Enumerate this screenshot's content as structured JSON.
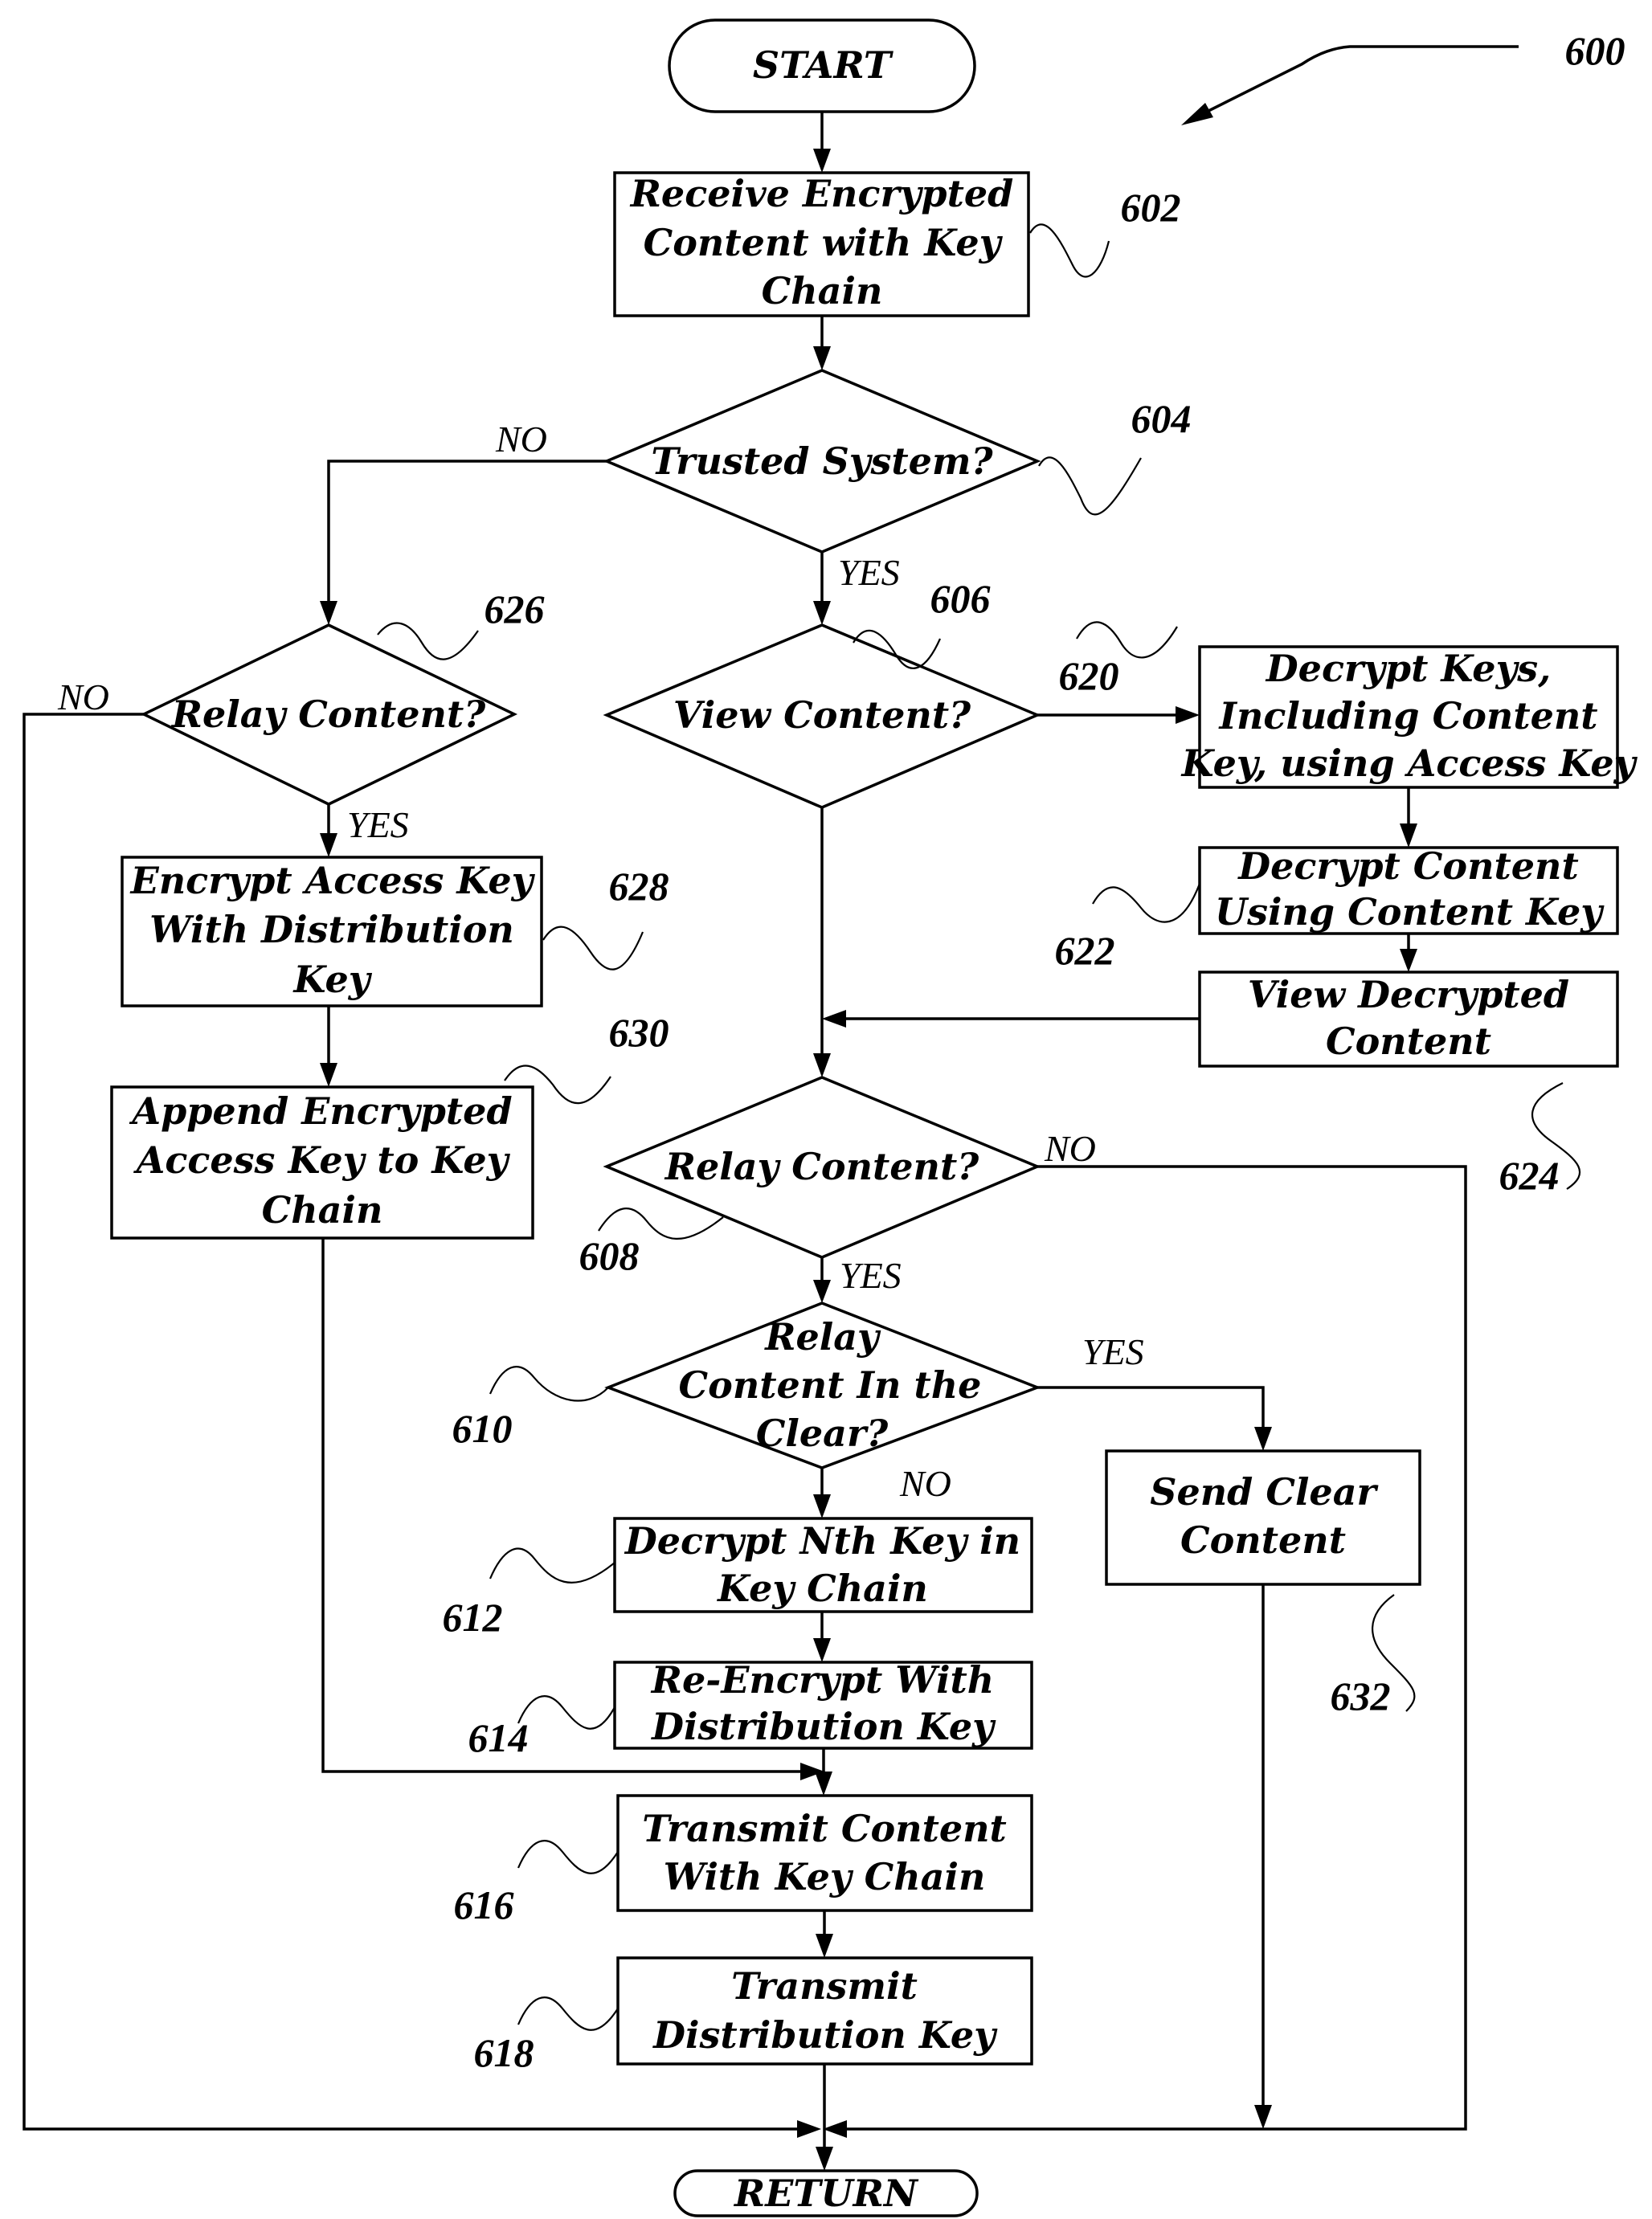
{
  "figure": {
    "reference": "600",
    "start_label": "START",
    "end_label": "RETURN"
  },
  "nodes": {
    "n602": {
      "ref": "602",
      "type": "process",
      "lines": [
        "Receive Encrypted",
        "Content with Key",
        "Chain"
      ]
    },
    "n604": {
      "ref": "604",
      "type": "decision",
      "lines": [
        "Trusted System?"
      ]
    },
    "n606": {
      "ref": "606",
      "type": "decision",
      "lines": [
        "View Content?"
      ]
    },
    "n620": {
      "ref": "620",
      "type": "process",
      "lines": [
        "Decrypt Keys,",
        "Including Content",
        "Key, using Access Key"
      ]
    },
    "n622": {
      "ref": "622",
      "type": "process",
      "lines": [
        "Decrypt Content",
        "Using Content Key"
      ]
    },
    "n624": {
      "ref": "624",
      "type": "process",
      "lines": [
        "View Decrypted",
        "Content"
      ]
    },
    "n626": {
      "ref": "626",
      "type": "decision",
      "lines": [
        "Relay Content?"
      ]
    },
    "n628": {
      "ref": "628",
      "type": "process",
      "lines": [
        "Encrypt Access Key",
        "With Distribution",
        "Key"
      ]
    },
    "n630": {
      "ref": "630",
      "type": "process",
      "lines": [
        "Append Encrypted",
        "Access Key to Key",
        "Chain"
      ]
    },
    "n608": {
      "ref": "608",
      "type": "decision",
      "lines": [
        "Relay Content?"
      ]
    },
    "n610": {
      "ref": "610",
      "type": "decision",
      "lines": [
        "Relay",
        "Content In the",
        "Clear?"
      ]
    },
    "n612": {
      "ref": "612",
      "type": "process",
      "lines": [
        "Decrypt Nth Key in",
        "Key Chain"
      ]
    },
    "n614": {
      "ref": "614",
      "type": "process",
      "lines": [
        "Re-Encrypt With",
        "Distribution Key"
      ]
    },
    "n616": {
      "ref": "616",
      "type": "process",
      "lines": [
        "Transmit Content",
        "With Key Chain"
      ]
    },
    "n618": {
      "ref": "618",
      "type": "process",
      "lines": [
        "Transmit",
        "Distribution Key"
      ]
    },
    "n632": {
      "ref": "632",
      "type": "process",
      "lines": [
        "Send Clear",
        "Content"
      ]
    }
  },
  "branches": {
    "b604_no": "NO",
    "b604_yes": "YES",
    "b626_no": "NO",
    "b626_yes": "YES",
    "b608_no": "NO",
    "b608_yes": "YES",
    "b610_yes": "YES",
    "b610_no": "NO"
  }
}
